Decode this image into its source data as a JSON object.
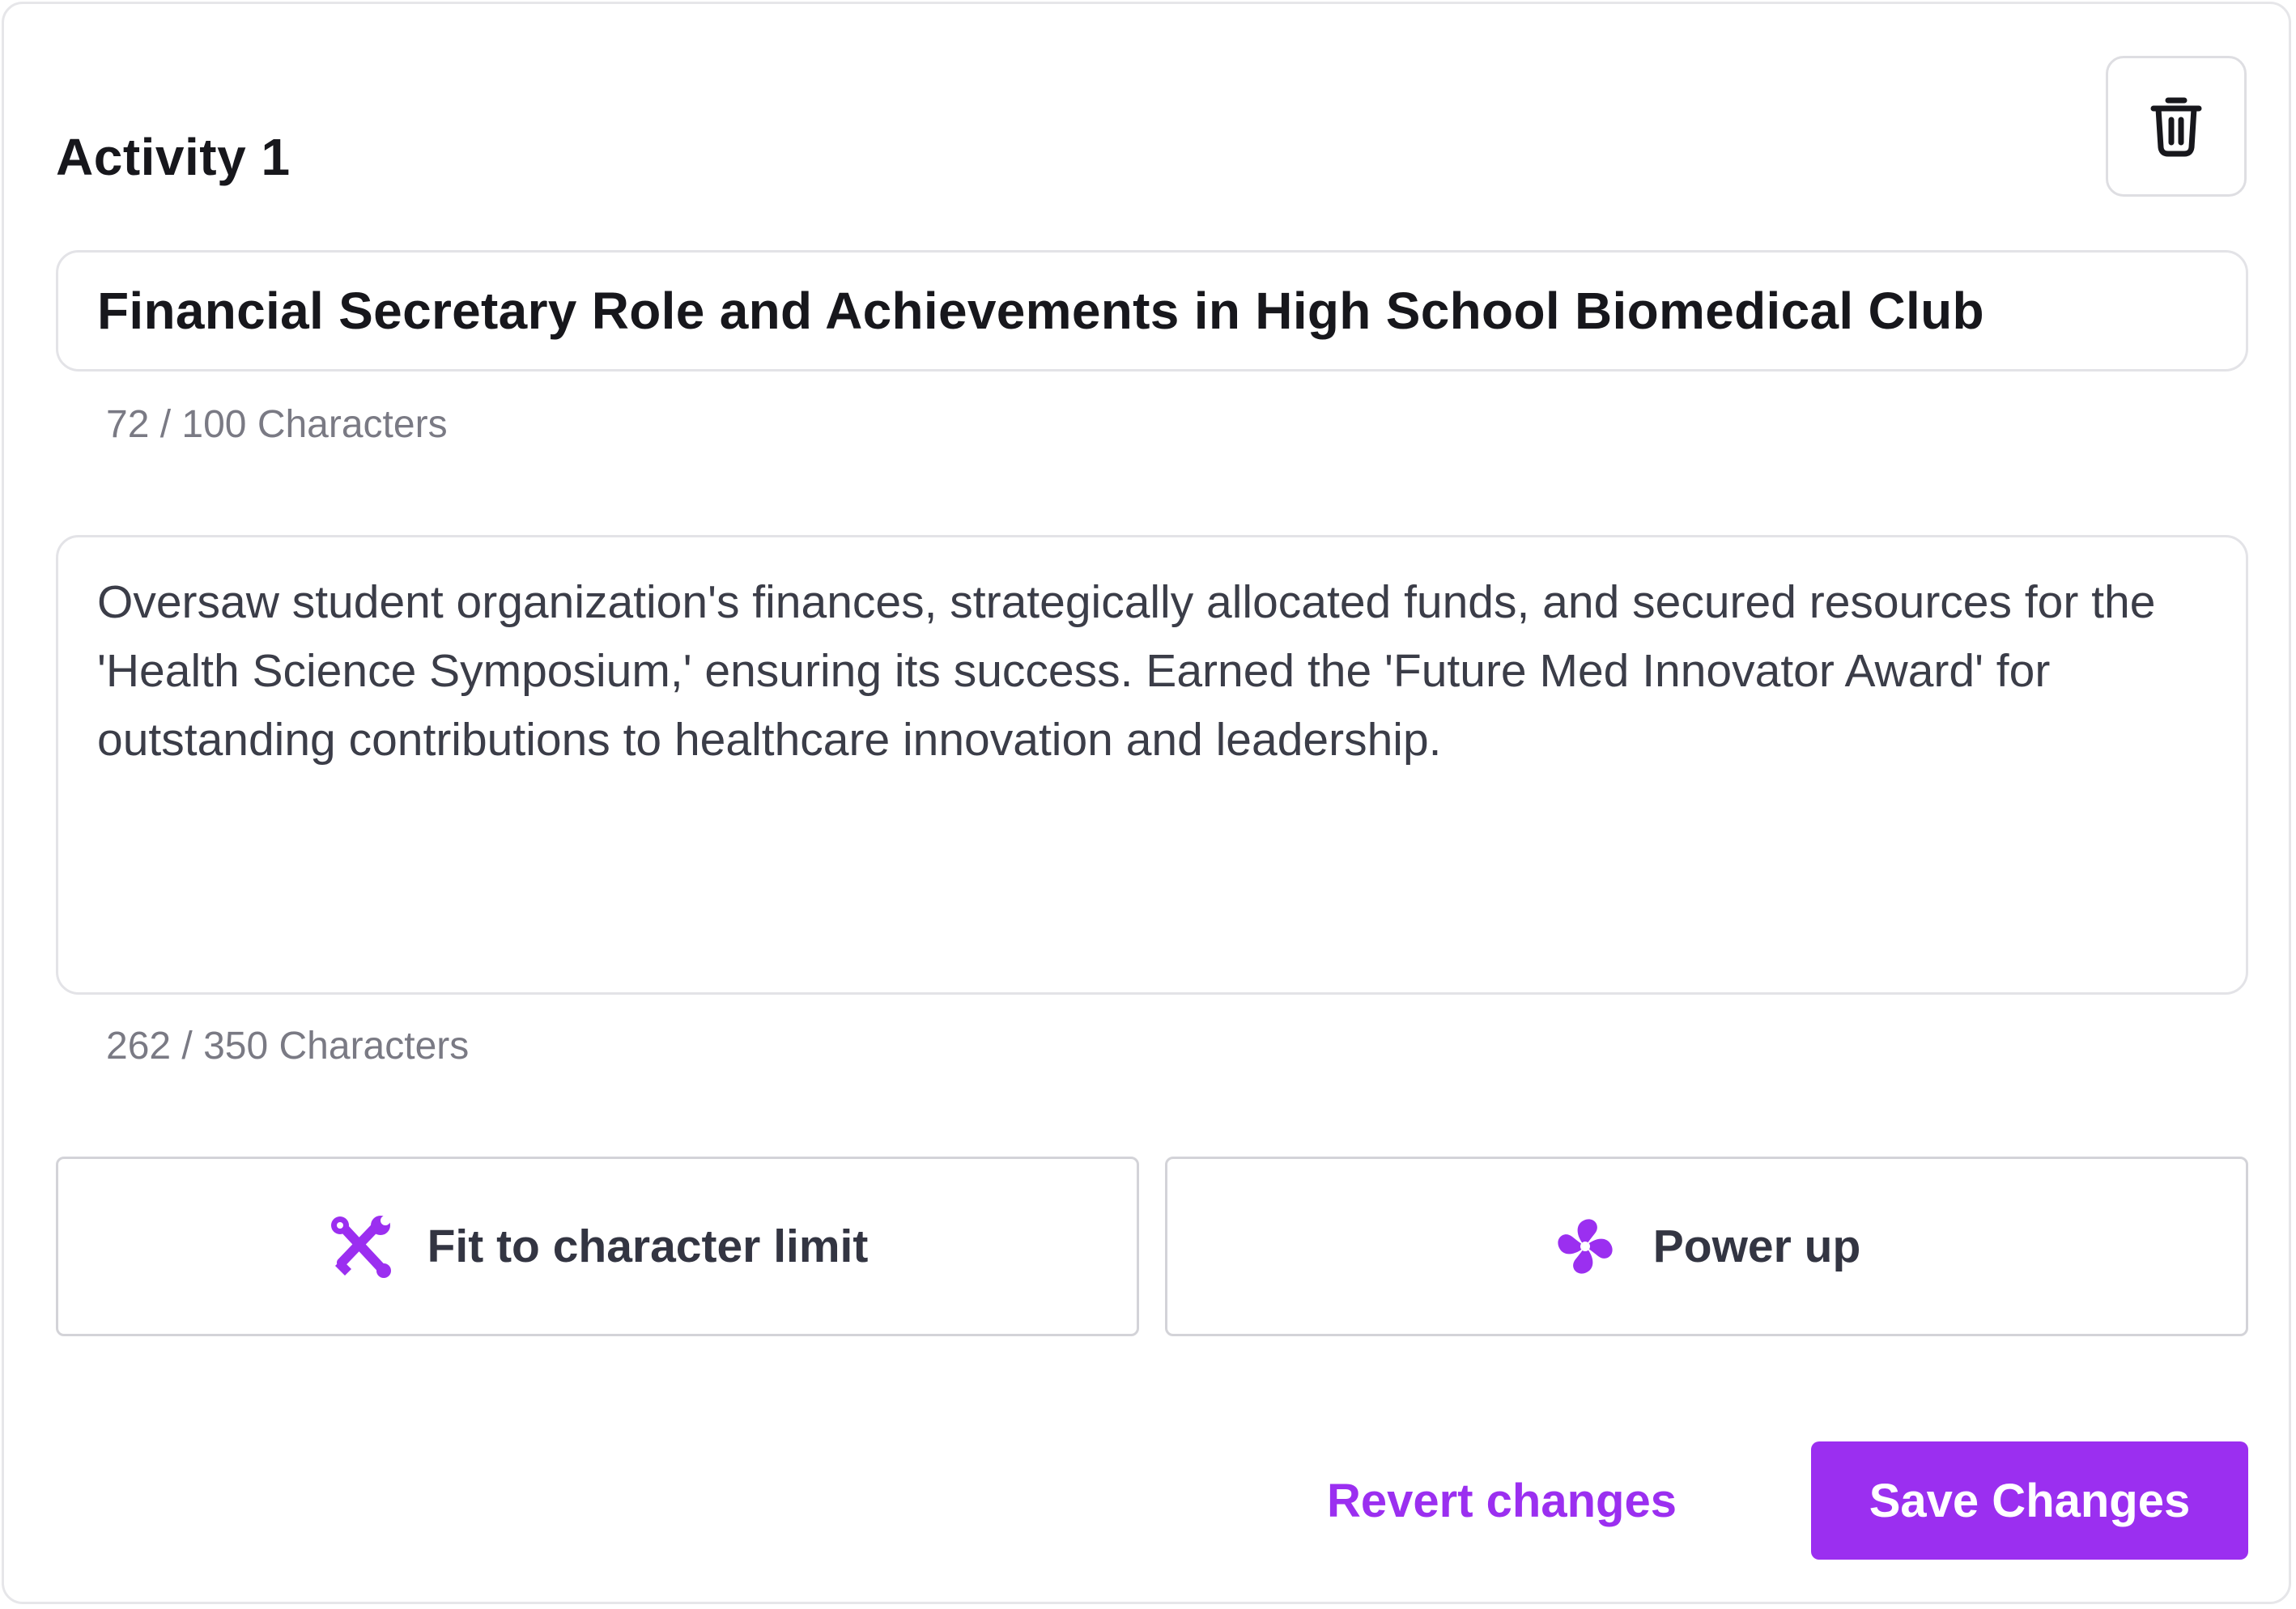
{
  "activity": {
    "title": "Activity 1",
    "delete_icon": "trash-icon"
  },
  "name_field": {
    "value": "Financial Secretary Role and Achievements in High School Biomedical Club",
    "counter": "72 / 100 Characters"
  },
  "description_field": {
    "value": "Oversaw student organization's finances, strategically allocated funds, and secured resources for the 'Health Science Symposium,' ensuring its success. Earned the 'Future Med Innovator Award' for outstanding contributions to healthcare innovation and leadership.",
    "counter": "262 / 350 Characters"
  },
  "actions": {
    "fit_label": "Fit to character limit",
    "fit_icon": "scissors-wrench-icon",
    "power_label": "Power up",
    "power_icon": "pinwheel-icon"
  },
  "footer": {
    "revert_label": "Revert changes",
    "save_label": "Save Changes"
  },
  "colors": {
    "accent": "#9B2FF0",
    "text_dark": "#17171C",
    "text_body": "#3B3D48",
    "text_muted": "#7A7A84",
    "border": "#E3E3E7"
  }
}
